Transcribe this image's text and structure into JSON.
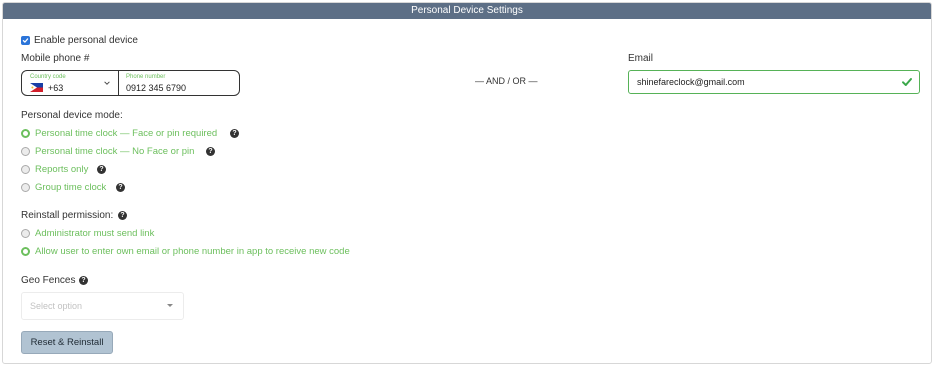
{
  "panel": {
    "title": "Personal Device Settings"
  },
  "enable_device": {
    "label": "Enable personal device",
    "checked": true
  },
  "mobile": {
    "label": "Mobile phone #",
    "country_code_label": "Country code",
    "country_code_value": "+63",
    "country_flag": "philippines-flag",
    "phone_number_label": "Phone number",
    "phone_number_value": "0912 345 6790"
  },
  "separator": "— AND / OR —",
  "email": {
    "label": "Email",
    "value": "shinefareclock@gmail.com",
    "valid": true
  },
  "device_mode": {
    "label": "Personal device mode:",
    "options": [
      {
        "label": "Personal time clock — Face or pin required",
        "selected": true,
        "help": "?"
      },
      {
        "label": "Personal time clock — No Face or pin",
        "selected": false,
        "help": "?"
      },
      {
        "label": "Reports only",
        "selected": false,
        "help": "?"
      },
      {
        "label": "Group time clock",
        "selected": false,
        "help": "?"
      }
    ]
  },
  "reinstall": {
    "label": "Reinstall permission:",
    "help": "?",
    "options": [
      {
        "label": "Administrator must send link",
        "selected": false
      },
      {
        "label": "Allow user to enter own email or phone number in app to receive new code",
        "selected": true
      }
    ]
  },
  "geo_fences": {
    "label": "Geo Fences",
    "help": "?",
    "placeholder": "Select option"
  },
  "actions": {
    "reset_reinstall": "Reset & Reinstall"
  },
  "colors": {
    "header": "#5d6f86",
    "accent_green": "#6cbf5d",
    "checkbox_blue": "#2b74d9",
    "button": "#b1c3d2"
  }
}
